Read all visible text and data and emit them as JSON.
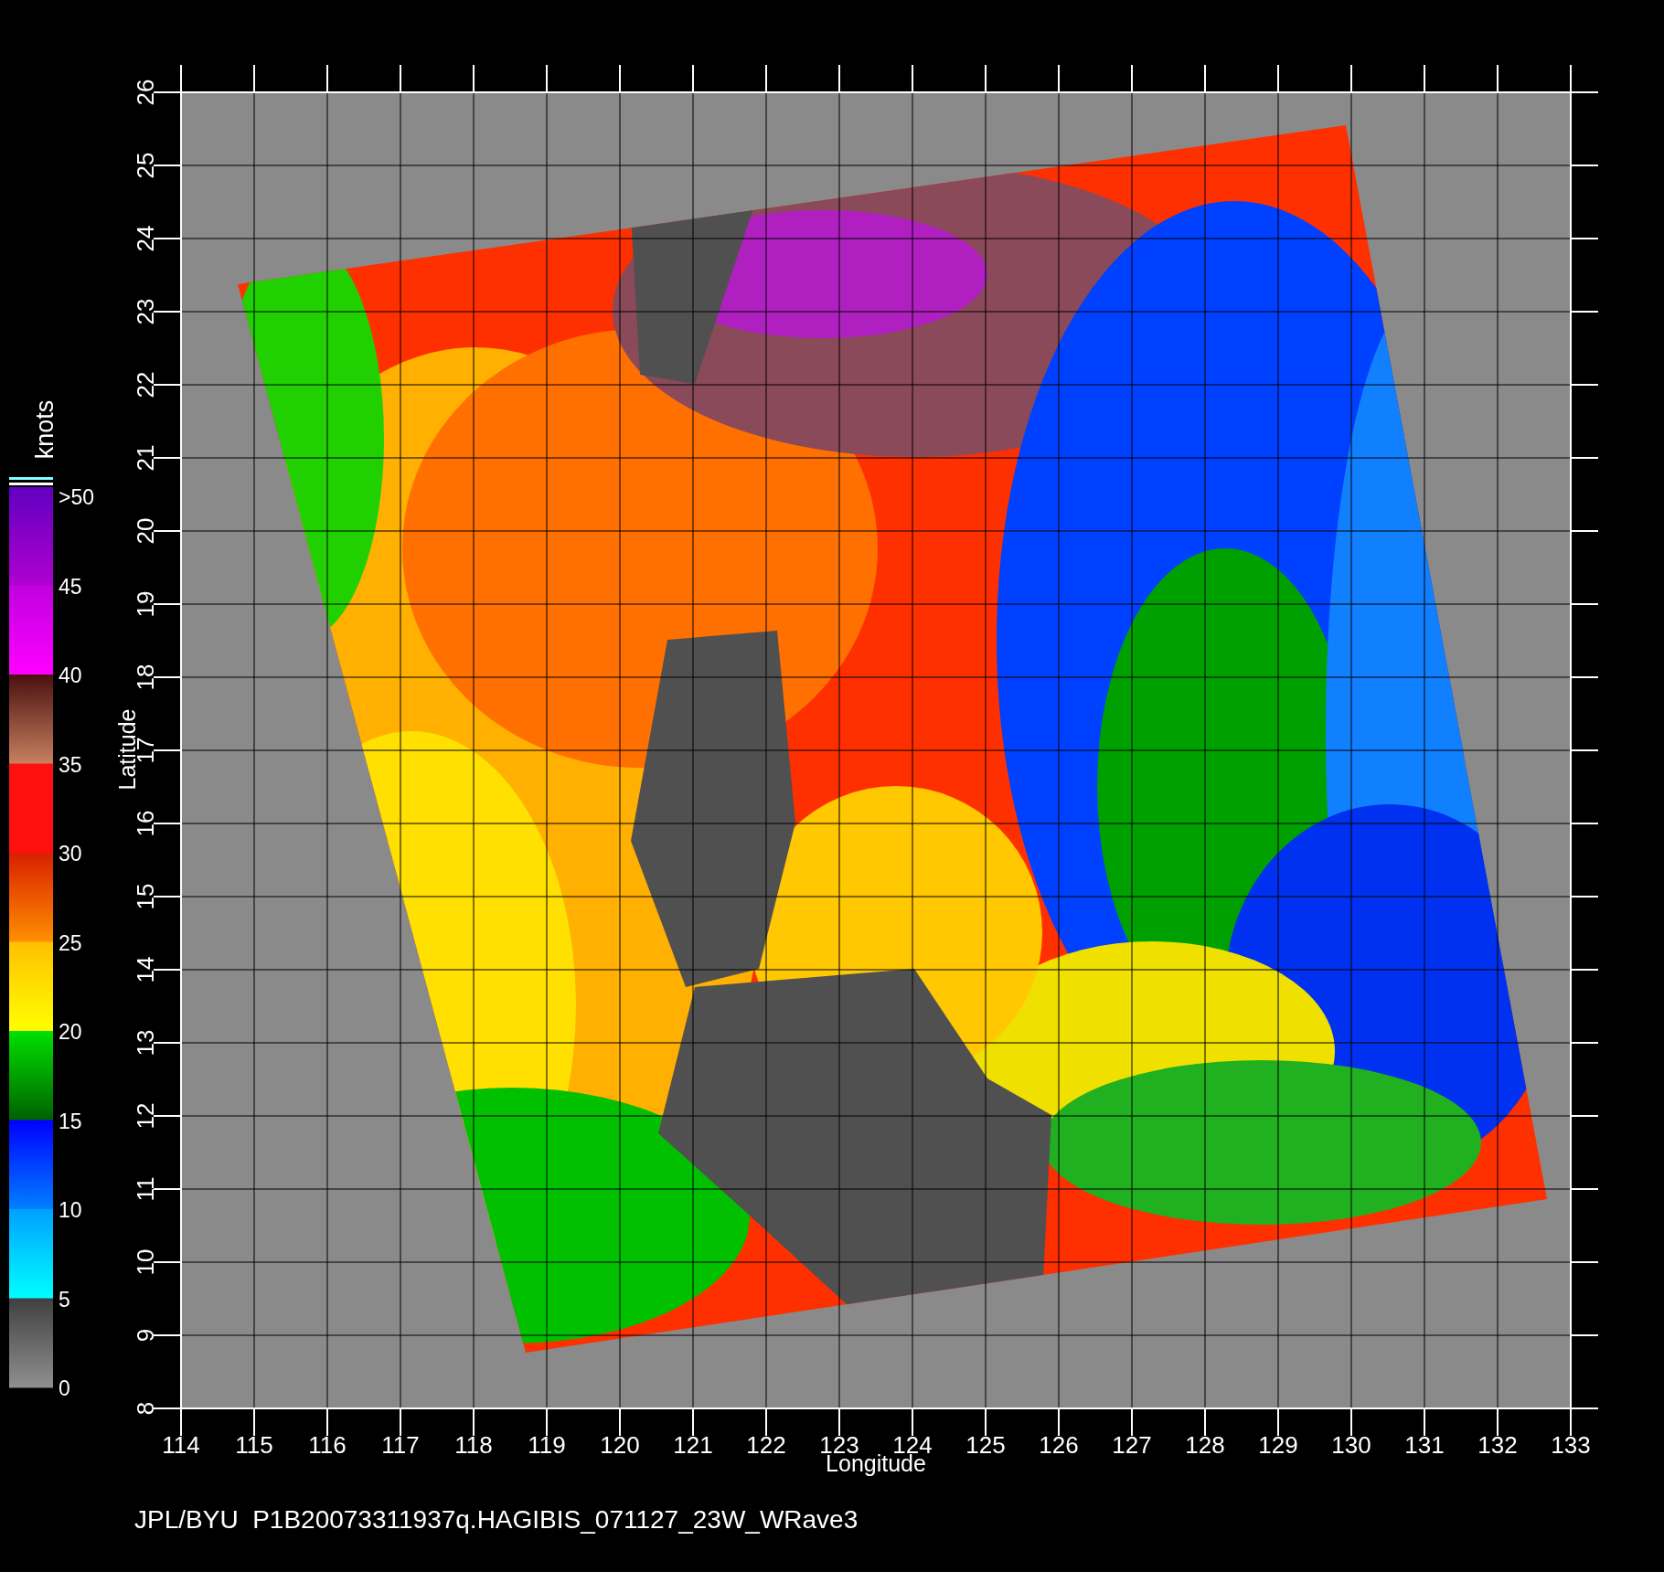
{
  "plot": {
    "x_label": "Longitude",
    "y_label": "Latitude",
    "x_ticks": [
      "114",
      "115",
      "116",
      "117",
      "118",
      "119",
      "120",
      "121",
      "122",
      "123",
      "124",
      "125",
      "126",
      "127",
      "128",
      "129",
      "130",
      "131",
      "132",
      "133"
    ],
    "y_ticks": [
      "8",
      "9",
      "10",
      "11",
      "12",
      "13",
      "14",
      "15",
      "16",
      "17",
      "18",
      "19",
      "20",
      "21",
      "22",
      "23",
      "24",
      "25",
      "26"
    ]
  },
  "colorbar": {
    "title": "knots",
    "labels": [
      ">50",
      "45",
      "40",
      "35",
      "30",
      "25",
      "20",
      "15",
      "10",
      "5",
      "0"
    ]
  },
  "footer": "JPL/BYU  P1B20073311937q.HAGIBIS_071127_23W_WRave3"
}
